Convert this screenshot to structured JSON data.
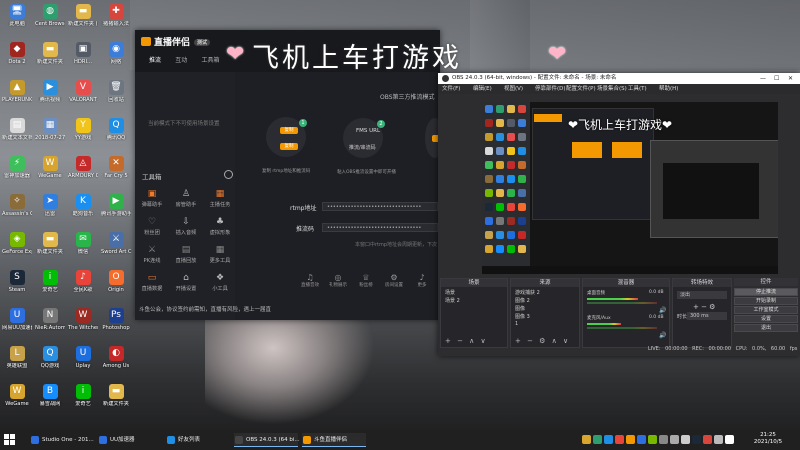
{
  "overlay": {
    "title": "飞机上车打游戏",
    "heart_left": "❤",
    "heart_right": "❤"
  },
  "desktop": {
    "icons": [
      {
        "label": "此电脑",
        "glyph": "🖥",
        "color": "#3b7dd8"
      },
      {
        "label": "Cent Browser",
        "glyph": "◍",
        "color": "#2f9e6e"
      },
      {
        "label": "新建文件夹 (2)",
        "glyph": "▬",
        "color": "#e2b84d"
      },
      {
        "label": "猪猪输入法",
        "glyph": "✚",
        "color": "#d8453d"
      },
      {
        "label": "Dota 2",
        "glyph": "◆",
        "color": "#a0271f"
      },
      {
        "label": "新建文件夹",
        "glyph": "▬",
        "color": "#e2b84d"
      },
      {
        "label": "HDRI...",
        "glyph": "▣",
        "color": "#555b66"
      },
      {
        "label": "网络",
        "glyph": "◉",
        "color": "#3b7dd8"
      },
      {
        "label": "PLAYERUNKNOWN'S BATTLEGR...",
        "glyph": "▲",
        "color": "#c49a2c"
      },
      {
        "label": "腾讯视频",
        "glyph": "▶",
        "color": "#2a8fdc"
      },
      {
        "label": "VALORANT",
        "glyph": "V",
        "color": "#e84d4d"
      },
      {
        "label": "回收站",
        "glyph": "🗑",
        "color": "#6d7580"
      },
      {
        "label": "新建文本文档",
        "glyph": "▤",
        "color": "#d9d9d9"
      },
      {
        "label": "2018-07-27 ...",
        "glyph": "▦",
        "color": "#6b8fc2"
      },
      {
        "label": "YY游戏",
        "glyph": "Y",
        "color": "#f0c419"
      },
      {
        "label": "腾讯QQ",
        "glyph": "Q",
        "color": "#1f8ee5"
      },
      {
        "label": "雷神加速器",
        "glyph": "⚡",
        "color": "#3fbf5c"
      },
      {
        "label": "WeGame",
        "glyph": "W",
        "color": "#d7a52e"
      },
      {
        "label": "ARMOURY CRATE",
        "glyph": "◬",
        "color": "#c42a2a"
      },
      {
        "label": "Far Cry 5",
        "glyph": "✕",
        "color": "#c46a2a"
      },
      {
        "label": "Assassin's Creed Od...",
        "glyph": "✧",
        "color": "#8a6b3a"
      },
      {
        "label": "迅雷",
        "glyph": "➤",
        "color": "#2f7fe0"
      },
      {
        "label": "酷狗音乐",
        "glyph": "K",
        "color": "#1a8ff0"
      },
      {
        "label": "腾讯手游助手",
        "glyph": "▶",
        "color": "#2fb24a"
      },
      {
        "label": "GeForce Experience",
        "glyph": "◈",
        "color": "#76b900"
      },
      {
        "label": "新建文件夹",
        "glyph": "▬",
        "color": "#e2b84d"
      },
      {
        "label": "微信",
        "glyph": "✉",
        "color": "#2ab54a"
      },
      {
        "label": "Sword Art Online Fa...",
        "glyph": "⚔",
        "color": "#4a6fa8"
      },
      {
        "label": "Steam",
        "glyph": "S",
        "color": "#1b2838"
      },
      {
        "label": "爱奇艺",
        "glyph": "i",
        "color": "#00be06"
      },
      {
        "label": "全民K歌",
        "glyph": "♪",
        "color": "#e8443a"
      },
      {
        "label": "Origin",
        "glyph": "O",
        "color": "#f56c2d"
      },
      {
        "label": "网易UU加速器",
        "glyph": "U",
        "color": "#2d6fe0"
      },
      {
        "label": "NieR:Automata",
        "glyph": "N",
        "color": "#777777"
      },
      {
        "label": "The Witcher 3 Wild Hunt",
        "glyph": "W",
        "color": "#9a2a22"
      },
      {
        "label": "Photoshop",
        "glyph": "Ps",
        "color": "#1d3f8f"
      },
      {
        "label": "英雄联盟",
        "glyph": "L",
        "color": "#c8a24a"
      },
      {
        "label": "QQ游戏",
        "glyph": "Q",
        "color": "#2a8fe0"
      },
      {
        "label": "Uplay",
        "glyph": "U",
        "color": "#1d6fe0"
      },
      {
        "label": "Among Us",
        "glyph": "◐",
        "color": "#c62828"
      },
      {
        "label": "WeGame",
        "glyph": "W",
        "color": "#d7a52e"
      },
      {
        "label": "暴雪战网",
        "glyph": "B",
        "color": "#148eff"
      },
      {
        "label": "爱奇艺",
        "glyph": "i",
        "color": "#00be06"
      },
      {
        "label": "新建文件夹",
        "glyph": "▬",
        "color": "#e2b84d"
      }
    ]
  },
  "stream_app": {
    "logo": "直播伴侣",
    "version": "测试",
    "tabs": [
      "推流",
      "互动",
      "工具箱"
    ],
    "side_note": "当前模式下不可使用场景设置",
    "tools_title": "工具箱",
    "tools": [
      {
        "label": "弹幕助手",
        "glyph": "▣",
        "color": "#f07a2a"
      },
      {
        "label": "房管助手",
        "glyph": "♙",
        "color": "#bbbbbb"
      },
      {
        "label": "主播任务",
        "glyph": "▦",
        "color": "#f07a2a"
      },
      {
        "label": "粉丝团",
        "glyph": "♡",
        "color": "#888888"
      },
      {
        "label": "插入音频",
        "glyph": "⇩",
        "color": "#bbbbbb"
      },
      {
        "label": "虚拟形象",
        "glyph": "♣",
        "color": "#bbbbbb"
      },
      {
        "label": "PK连线",
        "glyph": "⚔",
        "color": "#888888"
      },
      {
        "label": "直播回放",
        "glyph": "▤",
        "color": "#888888"
      },
      {
        "label": "更多工具",
        "glyph": "▦",
        "color": "#888888"
      },
      {
        "label": "直播数据",
        "glyph": "▭",
        "color": "#f07a2a"
      },
      {
        "label": "开播设置",
        "glyph": "⌂",
        "color": "#bbbbbb"
      },
      {
        "label": "小工具",
        "glyph": "❖",
        "color": "#bbbbbb"
      }
    ],
    "ticker": "斗鱼公会，协议签约前需知，直播有风险，遇上一届直",
    "header_sub": "OBS第三方推流模式",
    "step1_btn1": "复制",
    "step1_btn2": "复制",
    "step1_caption": "复制 rtmp地址和推流码",
    "step2_title": "FMS URL",
    "step2_sub": "推流/串流码",
    "step2_caption": "粘入OBS推流设置中即可开播",
    "rtmp_label": "rtmp地址",
    "rtmp_value": "••••••••••••••••••••••••••••••••",
    "key_label": "推流码",
    "key_value": "••••••••••••••••••••••••••••••••",
    "hint": "本窗口中rtmp地址会周期更新，下次",
    "bottom_tools": [
      {
        "label": "直播音效",
        "glyph": "♫"
      },
      {
        "label": "礼物展示",
        "glyph": "◎"
      },
      {
        "label": "粉丝榜",
        "glyph": "♕"
      },
      {
        "label": "房间设置",
        "glyph": "⚙"
      },
      {
        "label": "更多",
        "glyph": "♪"
      }
    ]
  },
  "obs": {
    "title": "OBS 24.0.3 (64-bit, windows) - 配置文件: 未命名 - 场景: 未命名",
    "menu": [
      "文件(F)",
      "编辑(E)",
      "视图(V)",
      "停靠部件(D)",
      "配置文件(P)",
      "场景集合(S)",
      "工具(T)",
      "帮助(H)"
    ],
    "preview_overlay": "❤飞机上车打游戏❤",
    "docks": {
      "scenes": {
        "title": "场景",
        "items": [
          "场景",
          "场景 2"
        ]
      },
      "sources": {
        "title": "来源",
        "items": [
          "游戏捕获 2",
          "图像 2",
          "图像",
          "图像 3",
          "1"
        ]
      },
      "mixer": {
        "title": "混音器",
        "tracks": [
          {
            "name": "桌面音频",
            "db": "0.0 dB",
            "level": 0.64
          },
          {
            "name": "麦克风/Aux",
            "db": "0.0 dB",
            "level": 0.42
          }
        ]
      },
      "transitions": {
        "title": "转场特效",
        "type": "淡出",
        "duration_label": "时长",
        "duration": "300 ms"
      },
      "controls": {
        "title": "控件",
        "buttons": [
          "停止推流",
          "开始录制",
          "工作室模式",
          "设置",
          "退出"
        ]
      }
    },
    "status": "LIVE: 00:00:00  REC: 00:00:00  CPU: 0.0%, 60.00 fps"
  },
  "taskbar": {
    "items": [
      {
        "label": "Studio One - 201...",
        "color": "#2d6fe0"
      },
      {
        "label": "UU加速器",
        "color": "#2d6fe0"
      },
      {
        "label": "好友列表",
        "color": "#1f8ee5"
      },
      {
        "label": "OBS 24.0.3 (64 bi...",
        "color": "#444444"
      },
      {
        "label": "斗鱼直播伴侣",
        "color": "#f39800"
      }
    ],
    "time": "21:25",
    "date": "2021/10/5"
  }
}
